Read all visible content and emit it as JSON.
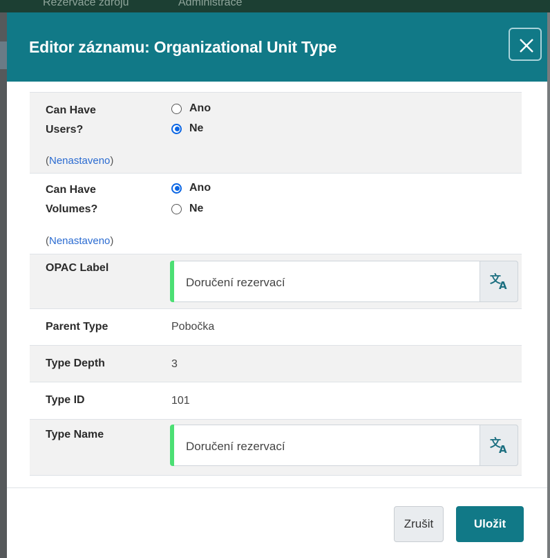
{
  "background": {
    "nav_items": [
      "Rezervace zdrojů",
      "Administrace"
    ]
  },
  "modal": {
    "title": "Editor záznamu: Organizational Unit Type",
    "close_icon": "close-x-icon",
    "header_color": "#117987"
  },
  "fields": {
    "can_have_users": {
      "label_line1": "Can Have",
      "label_line2": "Users?",
      "options": [
        "Ano",
        "Ne"
      ],
      "selected": "Ne",
      "unset_link": "Nenastaveno"
    },
    "can_have_volumes": {
      "label_line1": "Can Have",
      "label_line2": "Volumes?",
      "options": [
        "Ano",
        "Ne"
      ],
      "selected": "Ano",
      "unset_link": "Nenastaveno"
    },
    "opac_label": {
      "label": "OPAC Label",
      "value": "Doručení rezervací",
      "button_icon": "translate-icon"
    },
    "parent_type": {
      "label": "Parent Type",
      "value": "Pobočka"
    },
    "type_depth": {
      "label": "Type Depth",
      "value": "3"
    },
    "type_id": {
      "label": "Type ID",
      "value": "101"
    },
    "type_name": {
      "label": "Type Name",
      "value": "Doručení rezervací",
      "button_icon": "translate-icon"
    }
  },
  "footer": {
    "cancel_label": "Zrušit",
    "save_label": "Uložit"
  },
  "colors": {
    "accent": "#117987",
    "radio_selected": "#0b66e4",
    "required_marker": "#4cdf74",
    "link": "#2a6bd1"
  }
}
